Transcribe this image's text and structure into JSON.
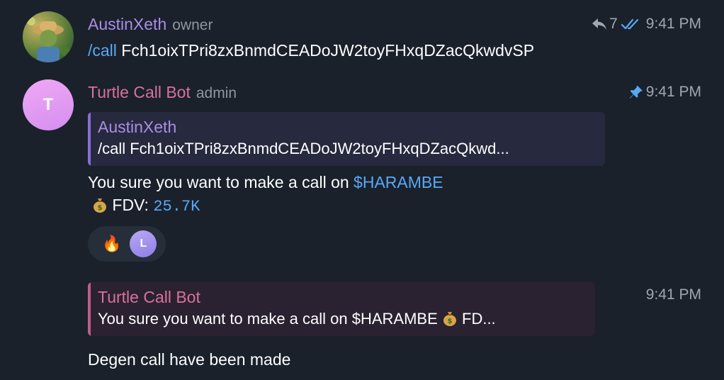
{
  "messages": [
    {
      "sender": "AustinXeth",
      "role": "owner",
      "reply_count": "7",
      "time": "9:41 PM",
      "command": "/call",
      "text": " Fch1oixTPri8zxBnmdCEADoJW2toyFHxqDZacQkwdvSP"
    },
    {
      "sender": "Turtle Call Bot",
      "role": "admin",
      "avatar_letter": "T",
      "time": "9:41 PM",
      "quote": {
        "name": "AustinXeth",
        "text": "/call Fch1oixTPri8zxBnmdCEADoJW2toyFHxqDZacQkwd..."
      },
      "line1_prefix": "You sure you want to make a call on ",
      "token": "$HARAMBE",
      "fdv_label": " FDV: ",
      "fdv_value": "25.7K",
      "reactions": {
        "emoji": "🔥",
        "avatar_letter": "L"
      }
    },
    {
      "time": "9:41 PM",
      "quote": {
        "name": "Turtle Call Bot",
        "text_prefix": "You sure you want to make a call on $HARAMBE ",
        "text_suffix": " FD..."
      },
      "text": "Degen call have been made"
    }
  ],
  "colors": {
    "background": "#1a212b",
    "austin_name": "#a98ee8",
    "bot_name": "#d9719b",
    "link": "#5aa8f5",
    "pin": "#5aa8f5"
  },
  "icons": [
    "reply-icon",
    "double-check-icon",
    "pin-icon",
    "money-bag-icon",
    "fire-emoji"
  ]
}
